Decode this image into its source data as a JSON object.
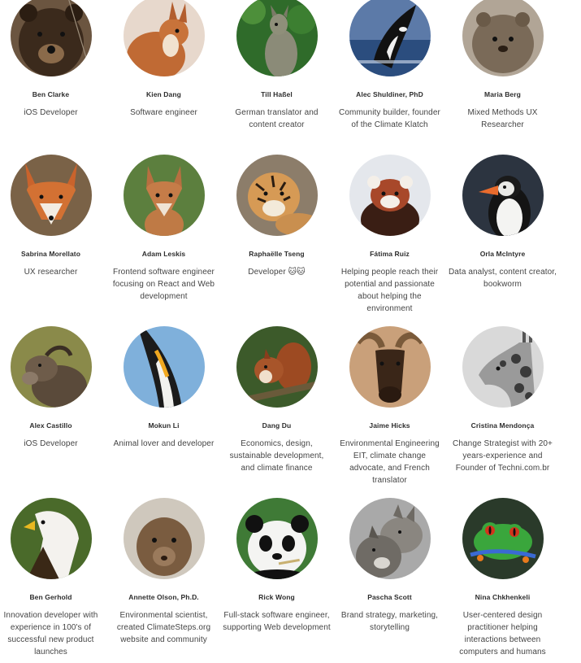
{
  "people": [
    {
      "name": "Ben Clarke",
      "role": "iOS Developer",
      "animal": "bear-avatar"
    },
    {
      "name": "Kien Dang",
      "role": "Software engineer",
      "animal": "squirrel-avatar"
    },
    {
      "name": "Till Haßel",
      "role": "German translator and content creator",
      "animal": "wallaby-avatar"
    },
    {
      "name": "Alec Shuldiner, PhD",
      "role": "Community builder, founder of the Climate Klatch",
      "animal": "orca-avatar"
    },
    {
      "name": "Maria Berg",
      "role": "Mixed Methods UX Researcher",
      "animal": "quokka-avatar"
    },
    {
      "name": "Sabrina Morellato",
      "role": "UX researcher",
      "animal": "red-fox-avatar"
    },
    {
      "name": "Adam Leskis",
      "role": "Frontend software engineer focusing on React and Web development",
      "animal": "fox-avatar"
    },
    {
      "name": "Raphaëlle Tseng",
      "role": "Developer 🐱🐱",
      "animal": "tiger-cub-avatar"
    },
    {
      "name": "Fátima Ruiz",
      "role": "Helping people reach their potential and passionate about helping the environment",
      "animal": "red-panda-avatar"
    },
    {
      "name": "Orla McIntyre",
      "role": "Data analyst, content creator, bookworm",
      "animal": "puffin-avatar"
    },
    {
      "name": "Alex Castillo",
      "role": "iOS Developer",
      "animal": "goat-avatar"
    },
    {
      "name": "Mokun Li",
      "role": "Animal lover and developer",
      "animal": "penguin-avatar"
    },
    {
      "name": "Dang Du",
      "role": "Economics, design, sustainable development, and climate finance",
      "animal": "squirrel-eating-avatar"
    },
    {
      "name": "Jaime Hicks",
      "role": "Environmental Engineering EIT, climate change advocate, and French translator",
      "animal": "moose-avatar"
    },
    {
      "name": "Cristina Mendonça",
      "role": "Change Strategist with 20+ years-experience and Founder of Techni.com.br",
      "animal": "giraffe-avatar"
    },
    {
      "name": "Ben Gerhold",
      "role": "Innovation developer with experience in 100's of successful new product launches",
      "animal": "eagle-avatar"
    },
    {
      "name": "Annette Olson, Ph.D.",
      "role": "Environmental scientist, created ClimateSteps.org website and community",
      "animal": "mongoose-avatar"
    },
    {
      "name": "Rick Wong",
      "role": "Full-stack software engineer, supporting Web development",
      "animal": "panda-avatar"
    },
    {
      "name": "Pascha Scott",
      "role": "Brand strategy, marketing, storytelling",
      "animal": "wolves-avatar"
    },
    {
      "name": "Nina Chkhenkeli",
      "role": "User-centered design practitioner helping interactions between computers and humans",
      "animal": "tree-frog-avatar"
    }
  ],
  "colors": {
    "text_name": "#2d2d2d",
    "text_role": "#444444",
    "background": "#ffffff"
  }
}
